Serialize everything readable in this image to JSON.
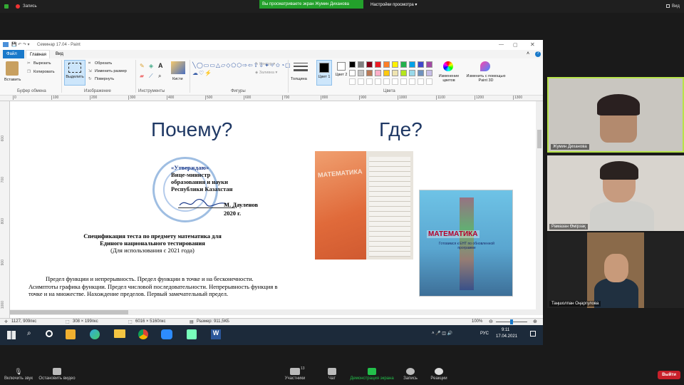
{
  "top": {
    "recording": "Запись",
    "share_banner": "Вы просматриваете экран Жумин Диханова",
    "view_options": "Настройки просмотра",
    "view": "Вид"
  },
  "paint": {
    "title": "Семинар 17.04 - Paint",
    "tabs": [
      "Файл",
      "Главная",
      "Вид"
    ],
    "clipboard": {
      "paste": "Вставить",
      "cut": "Вырезать",
      "copy": "Копировать",
      "label": "Буфер обмена"
    },
    "image": {
      "select": "Выделить",
      "crop": "Обрезать",
      "resize": "Изменить размер",
      "rotate": "Повернуть",
      "label": "Изображение"
    },
    "tools_label": "Инструменты",
    "brushes": "Кисти",
    "shapes": {
      "outline": "Контур",
      "fill": "Заливка",
      "label": "Фигуры"
    },
    "size": "Толщина",
    "color1": "Цвет 1",
    "color2": "Цвет 2",
    "colors_label": "Цвета",
    "edit_colors": "Изменение цветов",
    "paint3d": "Изменить с помощью Paint 3D",
    "ruler_ticks": [
      "0",
      "100",
      "200",
      "300",
      "400",
      "500",
      "600",
      "700",
      "800",
      "900",
      "1000",
      "1100",
      "1200",
      "1300"
    ],
    "vruler_ticks": [
      "600",
      "700",
      "800",
      "900",
      "1000"
    ],
    "palette": [
      "#000000",
      "#7f7f7f",
      "#880015",
      "#ed1c24",
      "#ff7f27",
      "#fff200",
      "#22b14c",
      "#00a2e8",
      "#3f48cc",
      "#a349a4",
      "#ffffff",
      "#c3c3c3",
      "#b97a57",
      "#ffaec9",
      "#ffc90e",
      "#efe4b0",
      "#b5e61d",
      "#99d9ea",
      "#7092be",
      "#c8bfe7"
    ],
    "status": {
      "pos": "1127, 909пкс",
      "sel": "308 × 199пкс",
      "size": "6016 × 5160пкс",
      "file": "Размер: 911,5КБ",
      "zoom": "100%"
    }
  },
  "slide": {
    "heading_left": "Почему?",
    "heading_right": "Где?",
    "stamp": [
      "«Утверждаю»",
      "Вице-министр",
      "образования и науки",
      "Республики Казахстан",
      "М. Дауленов",
      "2020 г."
    ],
    "spec_title": [
      "Спецификация теста по предмету математика для",
      "Единого национального тестирования"
    ],
    "spec_sub": "(Для использования с 2021 года)",
    "body": [
      "Предел функции и непрерывность. Предел функции в точке и на бесконечности.",
      "Асимптоты графика функции. Предел числовой последовательности. Непрерывность функция в",
      "точке и на множестве. Нахождение пределов. Первый замечательный предел."
    ],
    "book1": "МАТЕМАТИКА",
    "book2": "МАТЕМАТИКА",
    "book2_sub": "Готовимся к ЕНТ по обновленной программе"
  },
  "taskbar": {
    "lang": "РУС",
    "time": "9:11",
    "date": "17.04.2021"
  },
  "participants": [
    {
      "name": "Жумин Диханова"
    },
    {
      "name": "Рамазан Өмірзақ"
    },
    {
      "name": "Таңшолпан Оңаргүлова"
    }
  ],
  "zoom_toolbar": {
    "mute": "Включить звук",
    "video": "Остановить видео",
    "participants": "Участники",
    "participants_count": "13",
    "chat": "Чат",
    "share": "Демонстрация экрана",
    "record": "Запись",
    "reactions": "Реакции",
    "leave": "Выйти"
  }
}
